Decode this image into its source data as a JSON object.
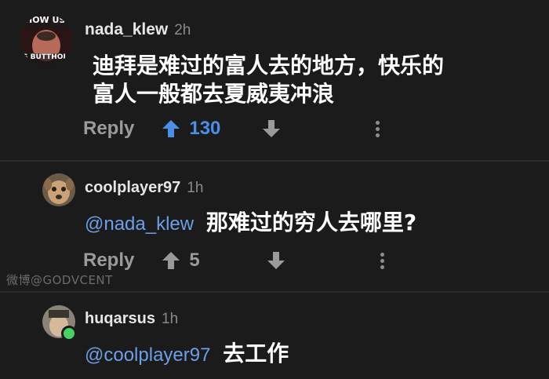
{
  "comments": [
    {
      "username": "nada_klew",
      "time": "2h",
      "avatar_text_top": "HOW US",
      "avatar_text_bottom": "S BUTTHOL",
      "text_line1": "迪拜是难过的富人去的地方，快乐的",
      "text_line2": "富人一般都去夏威夷冲浪",
      "reply_label": "Reply",
      "votes": "130",
      "upvoted": true
    },
    {
      "username": "coolplayer97",
      "time": "1h",
      "mention": "@nada_klew",
      "text": "那难过的穷人去哪里?",
      "reply_label": "Reply",
      "votes": "5",
      "upvoted": false
    },
    {
      "username": "huqarsus",
      "time": "1h",
      "mention": "@coolplayer97",
      "text": "去工作",
      "online": true
    }
  ],
  "watermark": "微博@GODVCENT",
  "colors": {
    "background": "#1b1b1c",
    "upvote_active": "#4a8fe7",
    "mention": "#6d9ee8",
    "online": "#46d160"
  }
}
